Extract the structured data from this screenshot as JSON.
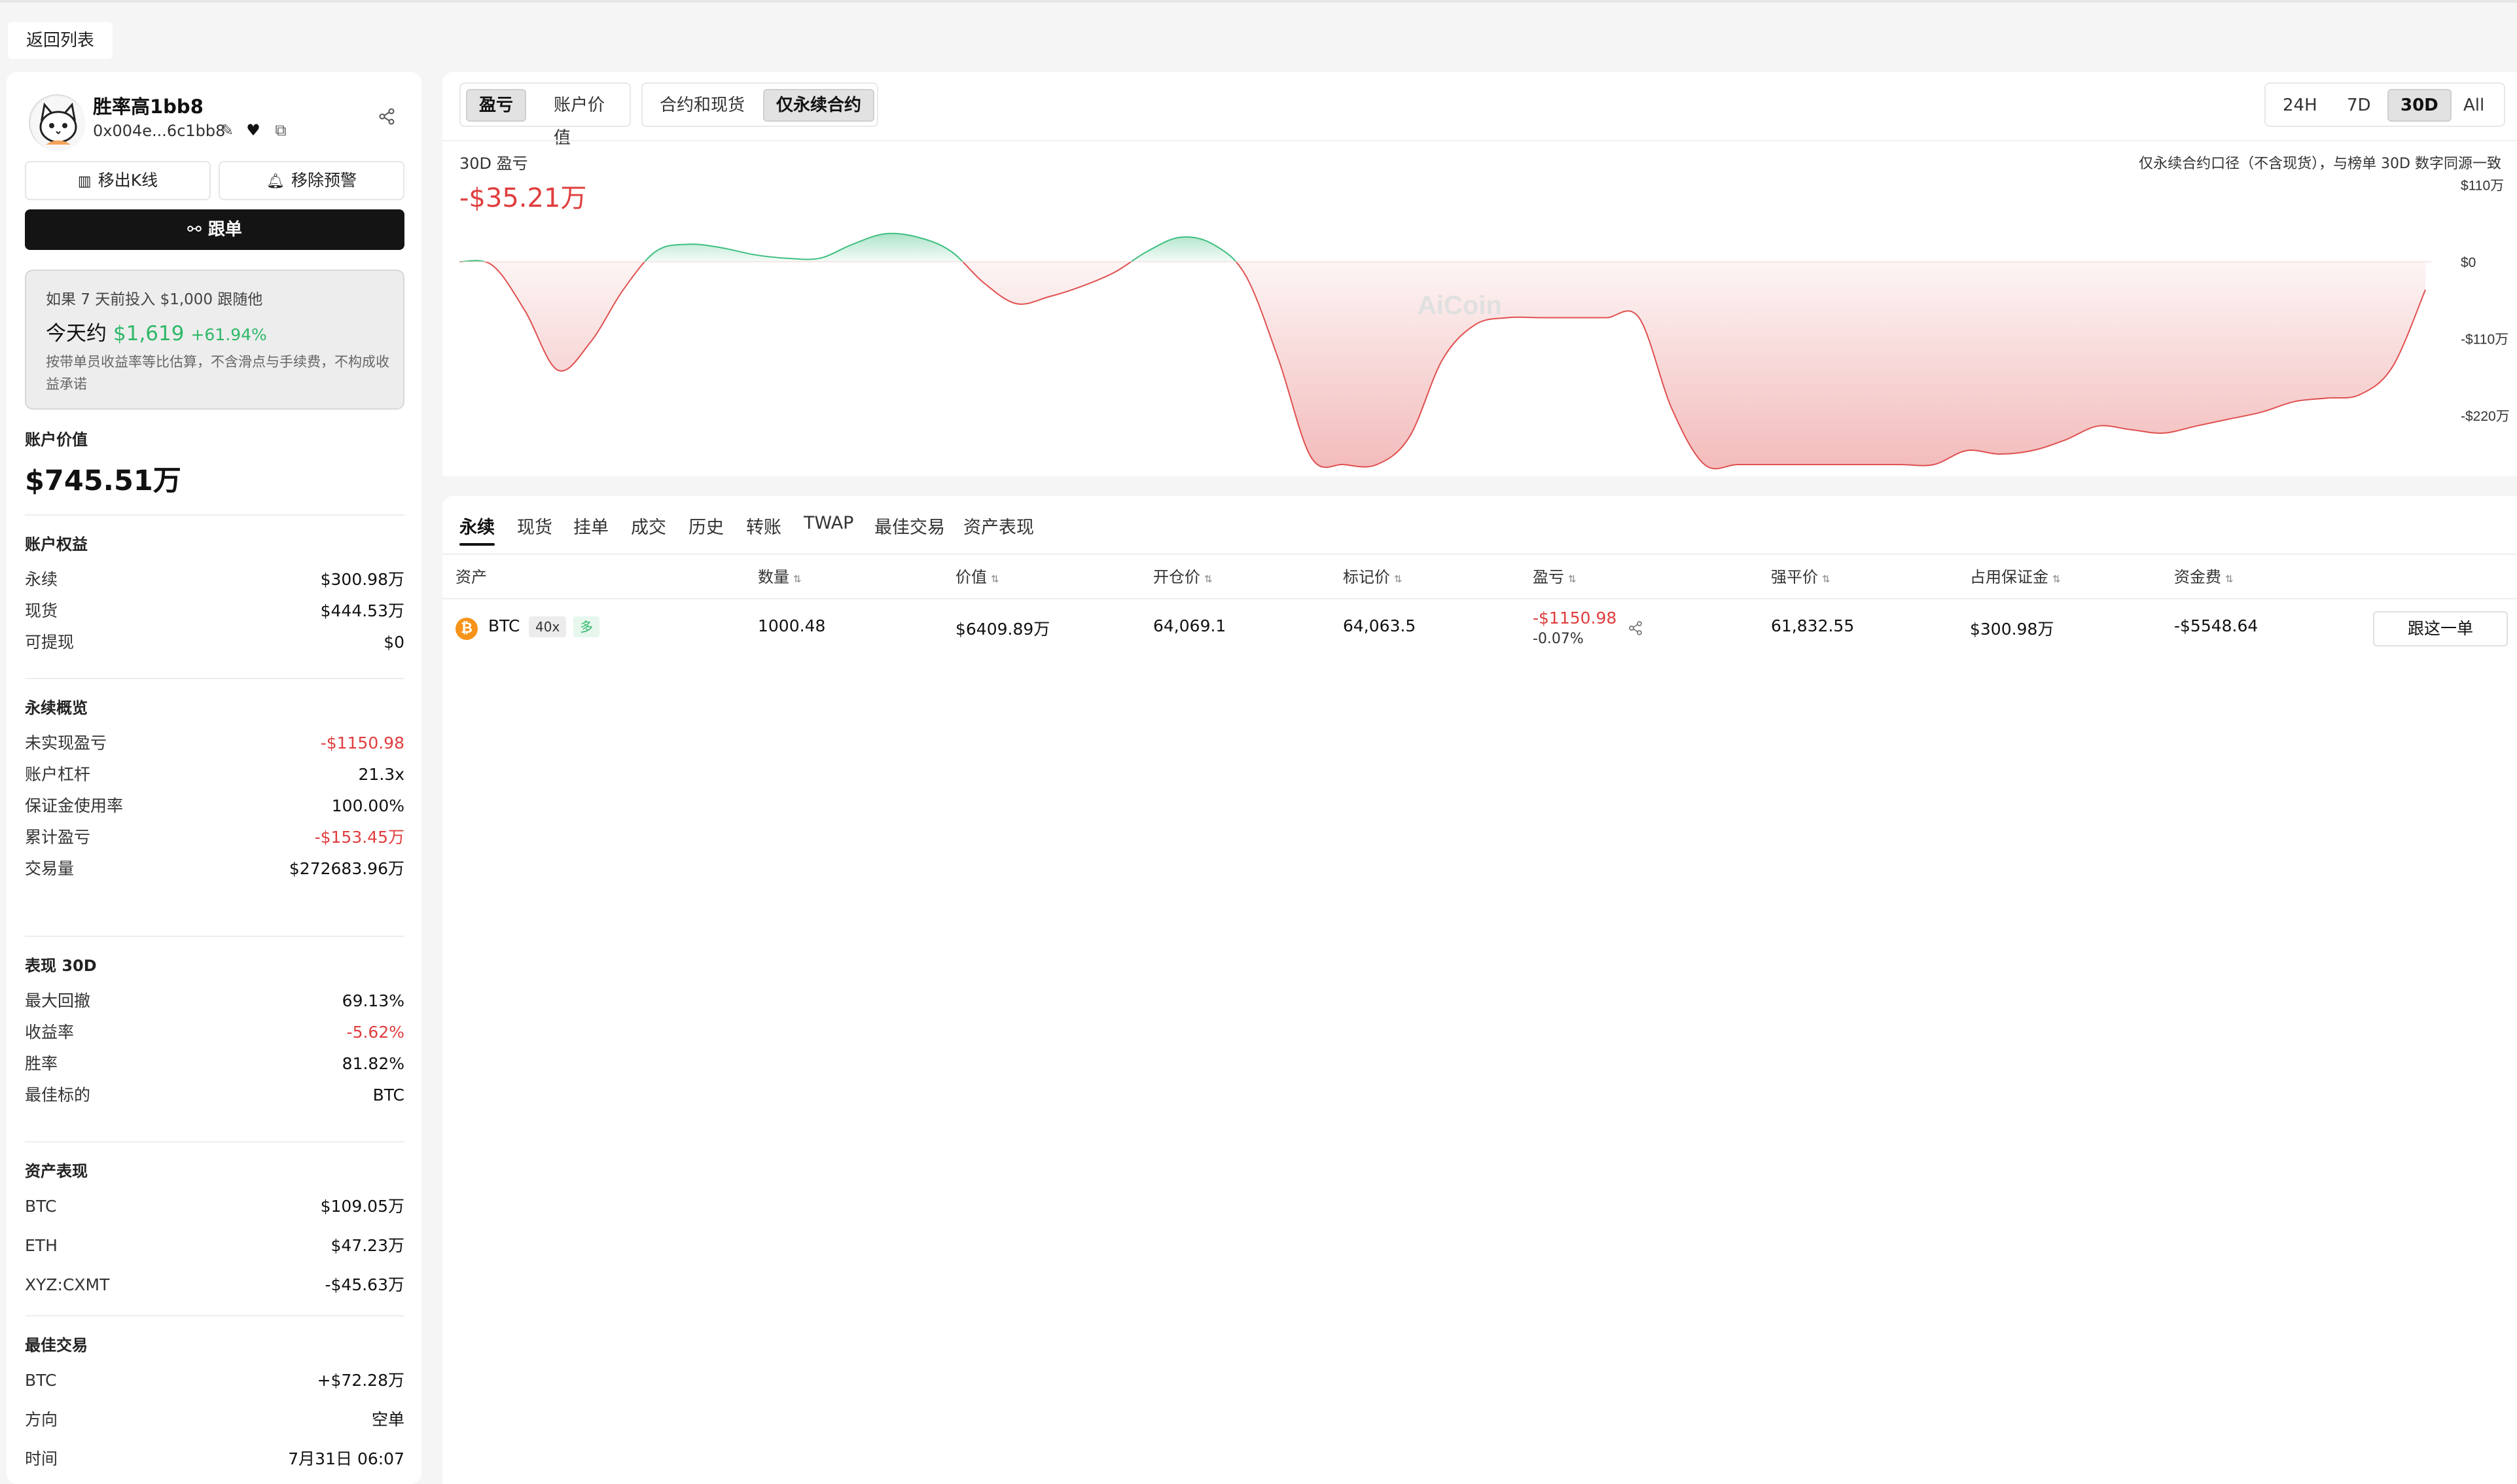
{
  "topbar": {
    "back_label": "返回列表"
  },
  "profile": {
    "name": "胜率高1bb8",
    "address": "0x004e...6c1bb8",
    "remove_kline_label": "移出K线",
    "remove_alert_label": "移除预警",
    "follow_label": "跟单"
  },
  "promo": {
    "line1": "如果 7 天前投入 $1,000 跟随他",
    "today_label": "今天约",
    "today_amount": "$1,619",
    "today_pct": "+61.94%",
    "disclaimer": "按带单员收益率等比估算，不含滑点与手续费，不构成收益承诺"
  },
  "account_value": {
    "title": "账户价值",
    "value": "$745.51万"
  },
  "equity": {
    "title": "账户权益",
    "rows": [
      {
        "label": "永续",
        "value": "$300.98万"
      },
      {
        "label": "现货",
        "value": "$444.53万"
      },
      {
        "label": "可提现",
        "value": "$0"
      }
    ]
  },
  "perp_overview": {
    "title": "永续概览",
    "rows": [
      {
        "label": "未实现盈亏",
        "value": "-$1150.98",
        "color": "#e03e3e"
      },
      {
        "label": "账户杠杆",
        "value": "21.3x"
      },
      {
        "label": "保证金使用率",
        "value": "100.00%"
      },
      {
        "label": "累计盈亏",
        "value": "-$153.45万",
        "color": "#e03e3e"
      },
      {
        "label": "交易量",
        "value": "$272683.96万"
      }
    ]
  },
  "performance": {
    "title": "表现 30D",
    "rows": [
      {
        "label": "最大回撤",
        "value": "69.13%"
      },
      {
        "label": "收益率",
        "value": "-5.62%",
        "color": "#e03e3e"
      },
      {
        "label": "胜率",
        "value": "81.82%"
      },
      {
        "label": "最佳标的",
        "value": "BTC"
      }
    ]
  },
  "asset_perf": {
    "title": "资产表现",
    "rows": [
      {
        "label": "BTC",
        "value": "$109.05万"
      },
      {
        "label": "ETH",
        "value": "$47.23万"
      },
      {
        "label": "XYZ:CXMT",
        "value": "-$45.63万"
      }
    ]
  },
  "best_trade": {
    "title": "最佳交易",
    "rows": [
      {
        "label": "BTC",
        "value": "+$72.28万"
      },
      {
        "label": "方向",
        "value": "空单"
      },
      {
        "label": "时间",
        "value": "7月31日 06:07"
      }
    ]
  },
  "chart_controls": {
    "metric_tabs": [
      "盈亏",
      "账户价值"
    ],
    "metric_active": "盈亏",
    "scope_tabs": [
      "合约和现货",
      "仅永续合约"
    ],
    "scope_active": "仅永续合约",
    "range_tabs": [
      "24H",
      "7D",
      "30D",
      "All"
    ],
    "range_active": "30D"
  },
  "chart_header": {
    "subtitle": "30D 盈亏",
    "value": "-$35.21万",
    "note": "仅永续合约口径（不含现货），与榜单 30D 数字同源一致",
    "watermark": "AiCoin"
  },
  "chart_data": {
    "type": "area",
    "y_unit": "万",
    "ylim": [
      -290,
      110
    ],
    "y_ticks": [
      110,
      0,
      -110,
      -220
    ],
    "y_tick_labels": [
      "$110万",
      "$0",
      "-$110万",
      "-$220万"
    ],
    "grid": false,
    "positive_color": "#3fbf80",
    "negative_color": "#e05050",
    "series": [
      {
        "x": [
          0,
          1,
          2,
          3,
          4,
          5,
          6,
          7,
          8,
          9,
          10,
          11,
          12,
          13,
          14,
          15,
          16,
          17,
          18,
          19,
          20,
          21,
          22,
          23,
          24,
          25,
          26,
          27,
          28,
          29,
          30,
          31,
          32,
          33,
          34,
          35,
          36,
          37,
          38,
          39,
          40,
          41,
          42,
          43,
          44,
          45,
          46,
          47,
          48,
          49,
          50,
          51,
          52,
          53,
          54,
          55,
          56,
          57,
          58,
          59,
          60
        ],
        "y": [
          0,
          -5,
          -70,
          -155,
          -115,
          -40,
          15,
          25,
          20,
          10,
          5,
          5,
          25,
          40,
          35,
          15,
          -30,
          -60,
          -50,
          -35,
          -15,
          15,
          35,
          25,
          -20,
          -140,
          -280,
          -290,
          -290,
          -250,
          -140,
          -90,
          -80,
          -80,
          -80,
          -80,
          -80,
          -210,
          -290,
          -290,
          -290,
          -290,
          -290,
          -290,
          -290,
          -290,
          -270,
          -275,
          -270,
          -255,
          -235,
          -240,
          -245,
          -235,
          -225,
          -215,
          -200,
          -195,
          -190,
          -150,
          -40
        ]
      }
    ]
  },
  "tabs": [
    "永续",
    "现货",
    "挂单",
    "成交",
    "历史",
    "转账",
    "TWAP",
    "最佳交易",
    "资产表现"
  ],
  "tab_active": "永续",
  "table": {
    "headers": [
      "资产",
      "数量",
      "价值",
      "开仓价",
      "标记价",
      "盈亏",
      "强平价",
      "占用保证金",
      "资金费"
    ],
    "rows": [
      {
        "asset": "BTC",
        "leverage": "40x",
        "side": "多",
        "quantity": "1000.48",
        "value": "$6409.89万",
        "entry_price": "64,069.1",
        "mark_price": "64,063.5",
        "pnl": "-$1150.98",
        "pnl_pct": "-0.07%",
        "liq_price": "61,832.55",
        "margin": "$300.98万",
        "funding": "-$5548.64",
        "action_label": "跟这一单"
      }
    ]
  }
}
